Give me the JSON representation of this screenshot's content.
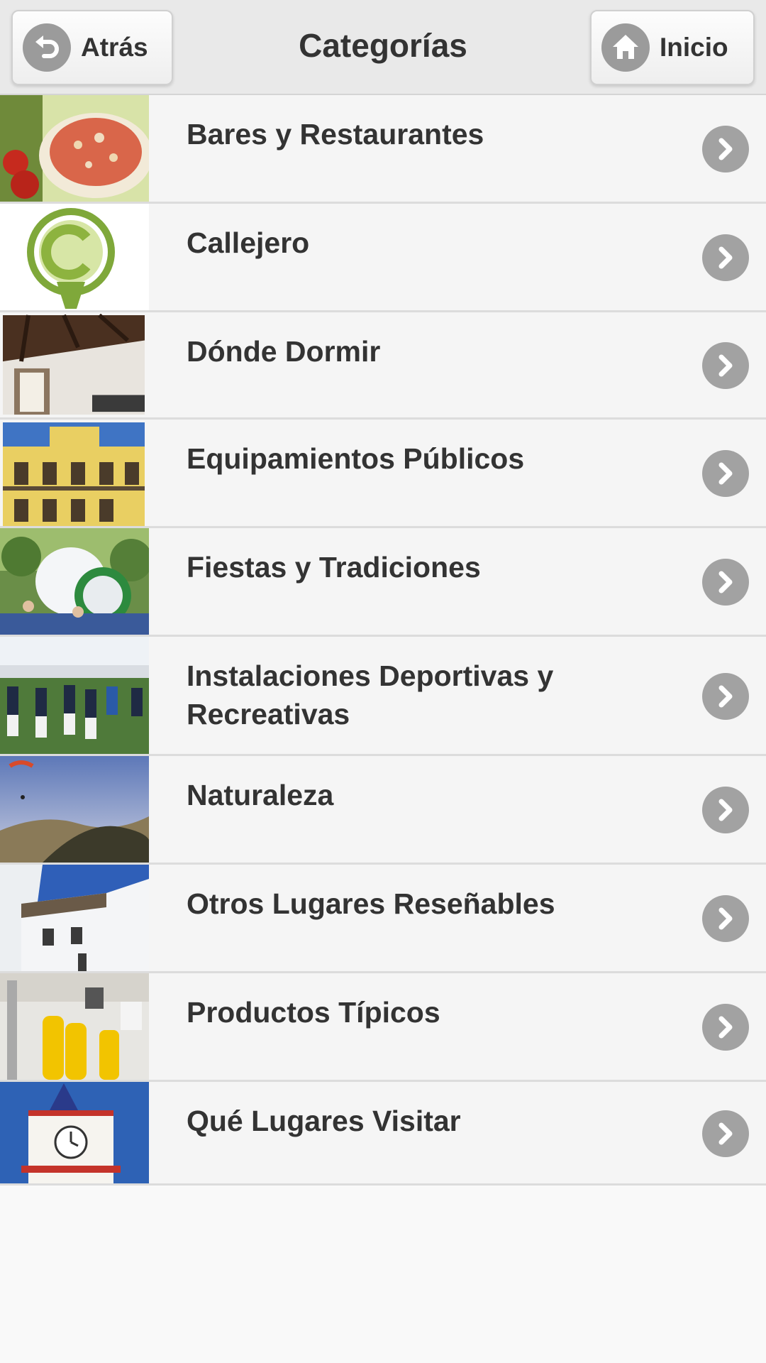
{
  "header": {
    "title": "Categorías",
    "back_label": "Atrás",
    "home_label": "Inicio"
  },
  "icons": {
    "back": "undo-arrow-icon",
    "home": "house-icon",
    "row_arrow": "chevron-right-icon"
  },
  "colors": {
    "header_bg": "#e9e9e9",
    "row_bg": "#f5f5f5",
    "icon_grey": "#a2a2a2",
    "text": "#333333"
  },
  "categories": [
    {
      "label": "Bares y Restaurantes"
    },
    {
      "label": "Callejero"
    },
    {
      "label": "Dónde Dormir"
    },
    {
      "label": "Equipamientos Públicos"
    },
    {
      "label": "Fiestas y Tradiciones"
    },
    {
      "label": "Instalaciones Deportivas y Recreativas"
    },
    {
      "label": "Naturaleza"
    },
    {
      "label": "Otros Lugares Reseñables"
    },
    {
      "label": "Productos Típicos"
    },
    {
      "label": "Qué Lugares Visitar"
    }
  ]
}
